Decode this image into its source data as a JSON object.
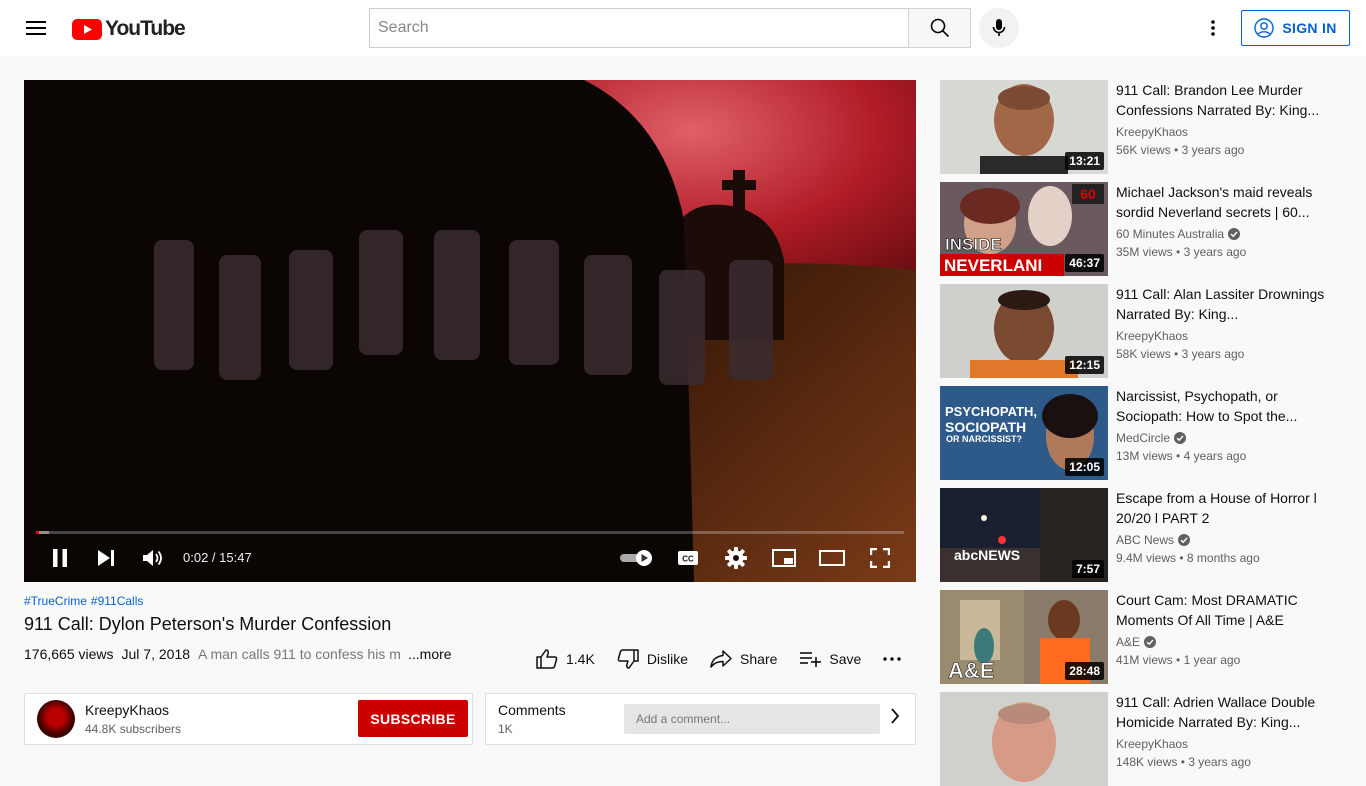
{
  "header": {
    "logo_text": "YouTube",
    "search_placeholder": "Search",
    "sign_in_label": "SIGN IN"
  },
  "player": {
    "progress_fraction": 0.002,
    "current_time": "0:02",
    "duration": "15:47",
    "time_text": "0:02 / 15:47"
  },
  "video": {
    "hashtags": [
      "#TrueCrime",
      "#911Calls"
    ],
    "title": "911 Call: Dylon Peterson's Murder Confession",
    "views": "176,665 views",
    "date": "Jul 7, 2018",
    "description_snippet": "A man calls 911 to confess his m",
    "more_label": "...more",
    "likes": "1.4K",
    "dislike_label": "Dislike",
    "share_label": "Share",
    "save_label": "Save"
  },
  "channel": {
    "name": "KreepyKhaos",
    "subscribers": "44.8K subscribers",
    "subscribe_label": "SUBSCRIBE"
  },
  "comments": {
    "title": "Comments",
    "count": "1K",
    "placeholder": "Add a comment..."
  },
  "recommendations": [
    {
      "title": "911 Call: Brandon Lee Murder Confessions Narrated By: King...",
      "channel": "KreepyKhaos",
      "verified": false,
      "views": "56K views",
      "age": "3 years ago",
      "duration": "13:21"
    },
    {
      "title": "Michael Jackson's maid reveals sordid Neverland secrets | 60...",
      "channel": "60 Minutes Australia",
      "verified": true,
      "views": "35M views",
      "age": "3 years ago",
      "duration": "46:37",
      "thumb_text": [
        "INSIDE",
        "NEVERLANI"
      ]
    },
    {
      "title": "911 Call: Alan Lassiter Drownings Narrated By: King...",
      "channel": "KreepyKhaos",
      "verified": false,
      "views": "58K views",
      "age": "3 years ago",
      "duration": "12:15"
    },
    {
      "title": "Narcissist, Psychopath, or Sociopath: How to Spot the...",
      "channel": "MedCircle",
      "verified": true,
      "views": "13M views",
      "age": "4 years ago",
      "duration": "12:05",
      "thumb_text": [
        "PSYCHOPATH,",
        "SOCIOPATH",
        "OR NARCISSIST?"
      ]
    },
    {
      "title": "Escape from a House of Horror l 20/20 l PART 2",
      "channel": "ABC News",
      "verified": true,
      "views": "9.4M views",
      "age": "8 months ago",
      "duration": "7:57",
      "thumb_text": [
        "abcNEWS"
      ]
    },
    {
      "title": "Court Cam: Most DRAMATIC Moments Of All Time | A&E",
      "channel": "A&E",
      "verified": true,
      "views": "41M views",
      "age": "1 year ago",
      "duration": "28:48",
      "thumb_text": [
        "A&E"
      ]
    },
    {
      "title": "911 Call: Adrien Wallace Double Homicide Narrated By: King...",
      "channel": "KreepyKhaos",
      "verified": false,
      "views": "148K views",
      "age": "3 years ago",
      "duration": ""
    }
  ]
}
